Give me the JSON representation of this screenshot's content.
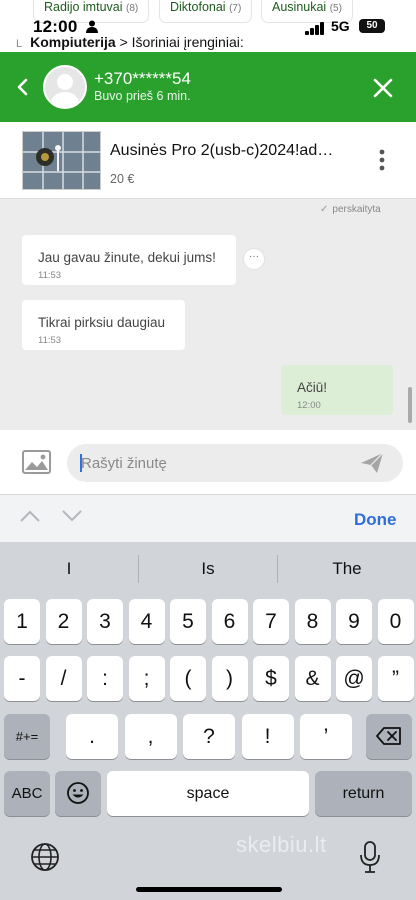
{
  "background": {
    "chips": [
      {
        "label": "Radijo imtuvai",
        "count": "(8)"
      },
      {
        "label": "Diktofonai",
        "count": "(7)"
      },
      {
        "label": "Ausinukai",
        "count": "(5)"
      }
    ],
    "status": {
      "time": "12:00",
      "network": "5G",
      "battery": "50"
    },
    "breadcrumb": {
      "prefix": "L",
      "root": "Kompiuterija",
      "separator": ">",
      "child": "Išoriniai įrenginiai:"
    }
  },
  "header": {
    "phone": "+370******54",
    "last_seen": "Buvo prieš 6 min."
  },
  "listing": {
    "title": "Ausinės Pro 2(usb-c)2024!ad…",
    "price": "20 €"
  },
  "chat": {
    "read_receipt": "perskaityta",
    "messages": [
      {
        "text": "Jau gavau žinute, dekui jums!",
        "time": "11:53",
        "from": "them"
      },
      {
        "text": "Tikrai pirksiu daugiau",
        "time": "11:53",
        "from": "them"
      },
      {
        "text": "Ačiū!",
        "time": "12:00",
        "from": "me"
      }
    ],
    "more_glyph": "···"
  },
  "composer": {
    "placeholder": "Rašyti žinutę"
  },
  "accessory": {
    "done": "Done"
  },
  "keyboard": {
    "suggestions": [
      "I",
      "Is",
      "The"
    ],
    "row_numbers": [
      "1",
      "2",
      "3",
      "4",
      "5",
      "6",
      "7",
      "8",
      "9",
      "0"
    ],
    "row_symbols": [
      "-",
      "/",
      ":",
      ";",
      "(",
      ")",
      "$",
      "&",
      "@",
      "”"
    ],
    "row_punct": [
      ".",
      ",",
      "?",
      "!",
      "’"
    ],
    "more_symbols": "#+=",
    "abc": "ABC",
    "space": "space",
    "return": "return"
  },
  "watermark": "skelbiu.lt",
  "colors": {
    "brand_green": "#2aa12d",
    "my_bubble": "#ddeed6",
    "done_blue": "#2f6edb"
  }
}
